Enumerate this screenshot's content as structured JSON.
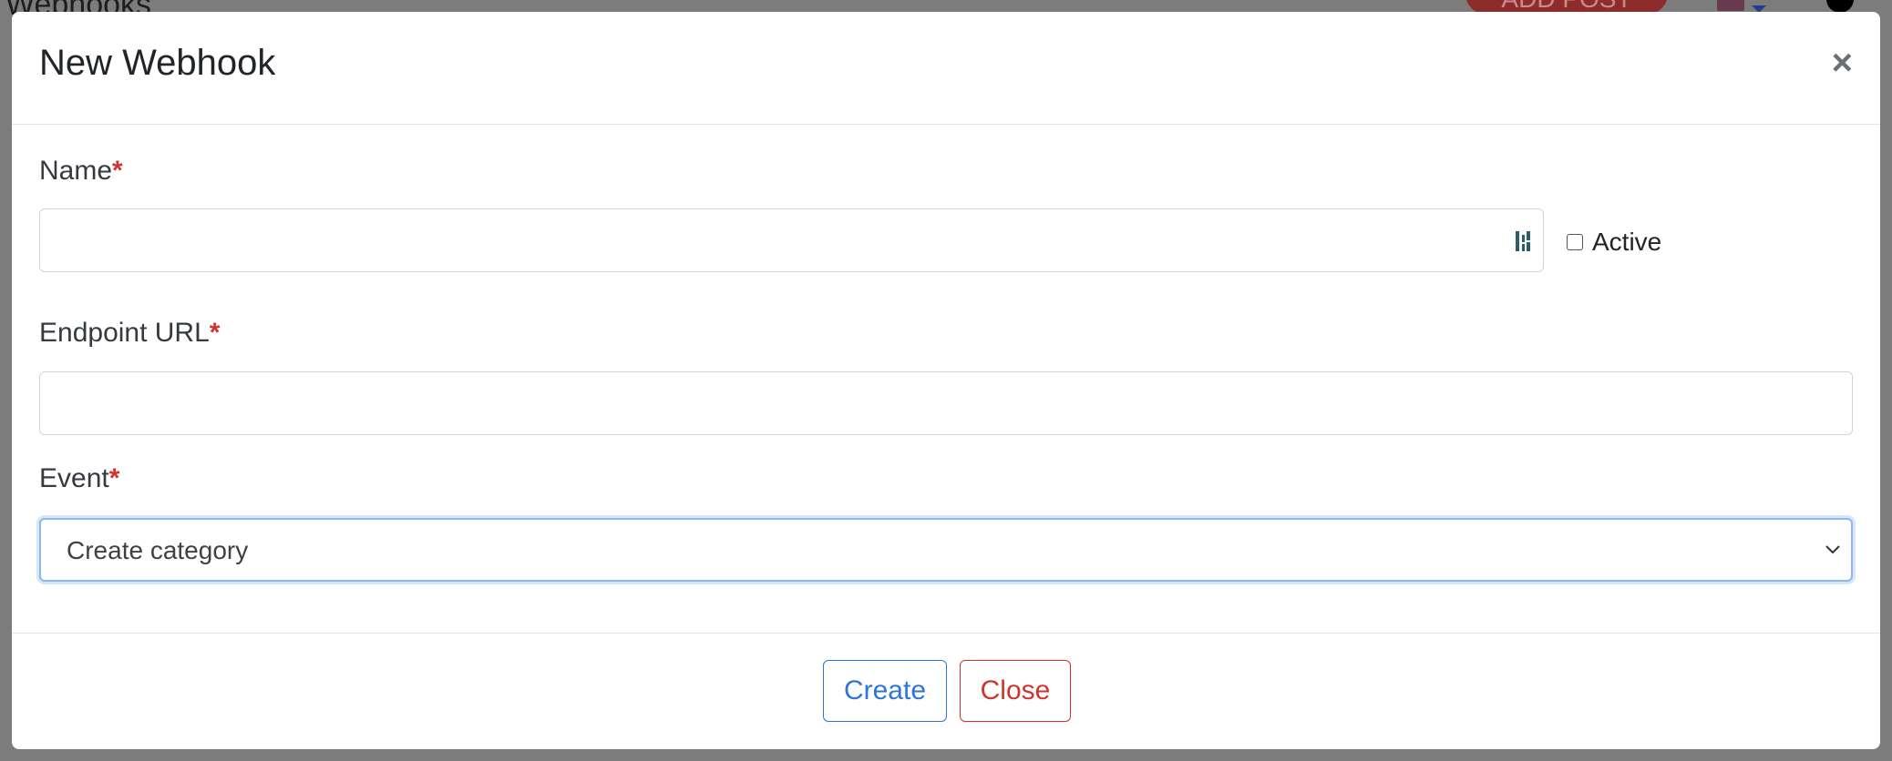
{
  "background": {
    "page_title": "Webhooks",
    "add_post_label": "ADD POST"
  },
  "modal": {
    "title": "New Webhook",
    "close_glyph": "×",
    "fields": {
      "name": {
        "label": "Name",
        "required_mark": "*",
        "value": "",
        "placeholder": ""
      },
      "active": {
        "label": "Active",
        "checked": false
      },
      "endpoint_url": {
        "label": "Endpoint URL",
        "required_mark": "*",
        "value": "",
        "placeholder": ""
      },
      "event": {
        "label": "Event",
        "required_mark": "*",
        "selected": "Create category"
      }
    },
    "buttons": {
      "create": "Create",
      "close": "Close"
    }
  },
  "colors": {
    "primary": "#2f74d8",
    "danger": "#d0342c",
    "backdrop": "#7c7c7c",
    "focus_ring": "#8bb8ee"
  },
  "icons": {
    "password_manager": "password-manager-icon",
    "select_caret": "chevron-down-icon",
    "modal_close": "close-icon"
  }
}
